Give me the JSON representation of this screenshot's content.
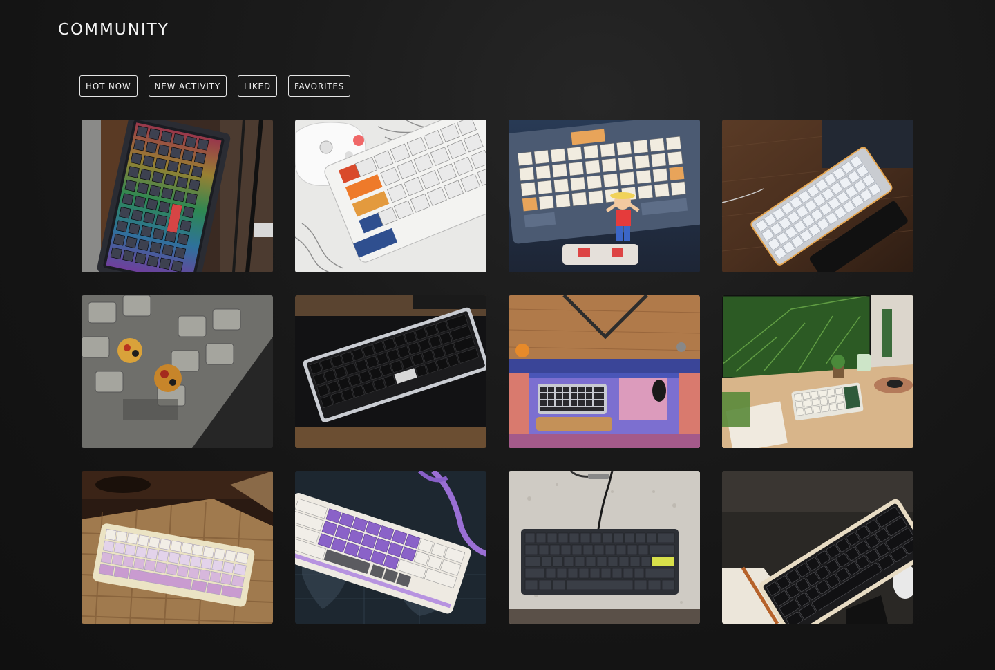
{
  "header": {
    "title": "COMMUNITY"
  },
  "filters": [
    {
      "label": "HOT NOW"
    },
    {
      "label": "NEW ACTIVITY"
    },
    {
      "label": "LIKED"
    },
    {
      "label": "FAVORITES"
    }
  ],
  "gallery": {
    "items": [
      {
        "icon": "rgb-keyboard-photo"
      },
      {
        "icon": "white-keyboard-controller-photo"
      },
      {
        "icon": "figure-keyboard-photo"
      },
      {
        "icon": "white-keyboard-wristrest-photo"
      },
      {
        "icon": "artisan-keycaps-photo"
      },
      {
        "icon": "black-keyboard-silver-case-photo"
      },
      {
        "icon": "blue-desk-setup-photo"
      },
      {
        "icon": "green-desk-setup-photo"
      },
      {
        "icon": "pink-keyboard-woven-mat-photo"
      },
      {
        "icon": "purple-keyboard-map-photo"
      },
      {
        "icon": "grey-keyboard-granite-photo"
      },
      {
        "icon": "black-keyboard-cream-case-photo"
      }
    ]
  }
}
